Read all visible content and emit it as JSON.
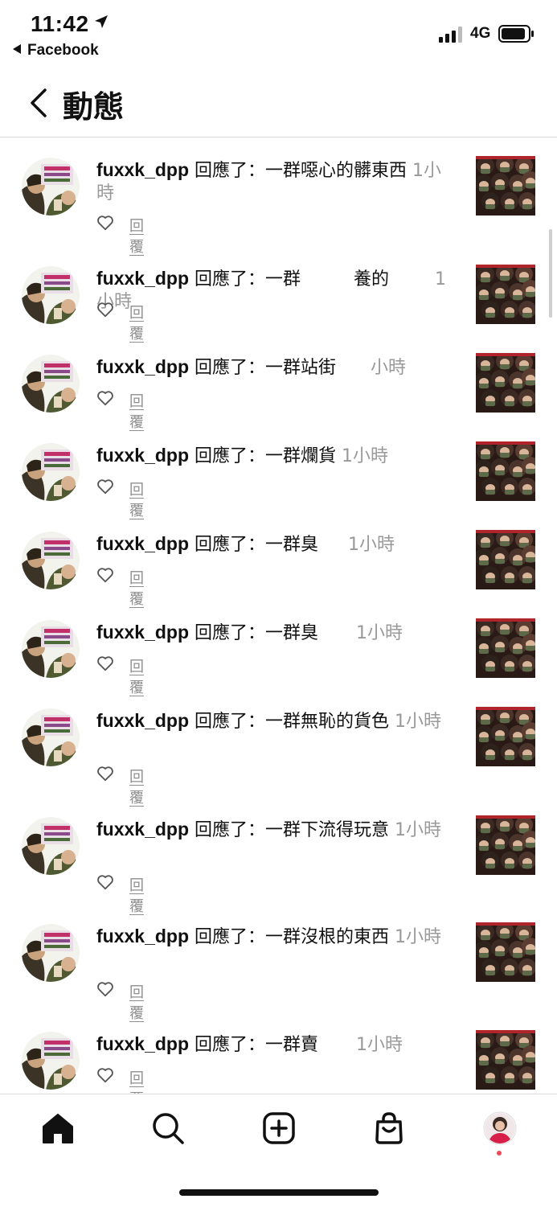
{
  "status_bar": {
    "time": "11:42",
    "back_app": "Facebook",
    "network": "4G"
  },
  "header": {
    "title": "動態"
  },
  "activity": {
    "reply_label": "回覆",
    "items": [
      {
        "username": "fuxxk_dpp",
        "action": " 回應了：",
        "comment": "一群噁心的髒東西",
        "time_ago": "1小時"
      },
      {
        "username": "fuxxk_dpp",
        "action": " 回應了：",
        "comment": "一群　　　養的",
        "time_ago": "1小時"
      },
      {
        "username": "fuxxk_dpp",
        "action": " 回應了：",
        "comment": "一群站街",
        "time_ago": "小時"
      },
      {
        "username": "fuxxk_dpp",
        "action": " 回應了：",
        "comment": "一群爛貨",
        "time_ago": "1小時"
      },
      {
        "username": "fuxxk_dpp",
        "action": " 回應了：",
        "comment": "一群臭",
        "time_ago": "1小時"
      },
      {
        "username": "fuxxk_dpp",
        "action": " 回應了：",
        "comment": "一群臭",
        "time_ago": "1小時"
      },
      {
        "username": "fuxxk_dpp",
        "action": " 回應了：",
        "comment": "一群無恥的貨色",
        "time_ago": "1小時"
      },
      {
        "username": "fuxxk_dpp",
        "action": " 回應了：",
        "comment": "一群下流得玩意",
        "time_ago": "1小時"
      },
      {
        "username": "fuxxk_dpp",
        "action": " 回應了：",
        "comment": "一群沒根的東西",
        "time_ago": "1小時"
      },
      {
        "username": "fuxxk_dpp",
        "action": " 回應了：",
        "comment": "一群賣",
        "time_ago": "1小時"
      }
    ]
  },
  "bottom_nav": {
    "items": [
      "home-icon",
      "search-icon",
      "new-post-icon",
      "shop-icon",
      "profile-avatar"
    ]
  },
  "colors": {
    "text": "#111111",
    "muted": "#8e8e8e",
    "divider": "#dbdbdb",
    "notification_dot": "#ed4956"
  }
}
